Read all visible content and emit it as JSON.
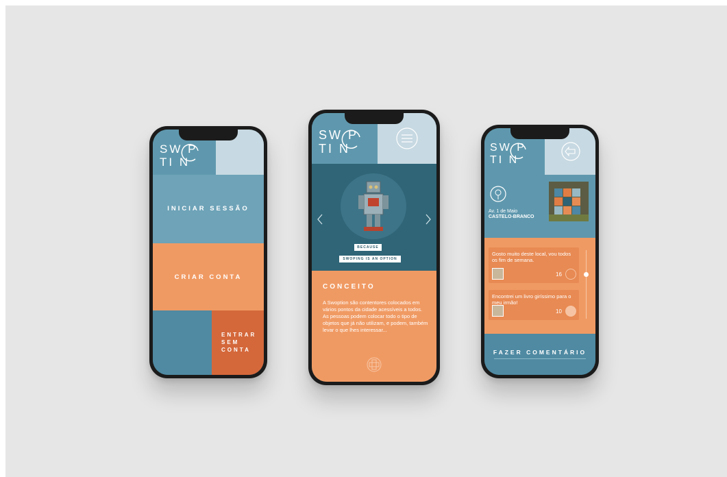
{
  "brand": {
    "logo_line1": "SW P",
    "logo_line2": "TI N"
  },
  "phone_left": {
    "login_label": "INICIAR SESSÃO",
    "signup_label": "CRIAR CONTA",
    "guest_label_1": "ENTRAR",
    "guest_label_2": "SEM",
    "guest_label_3": "CONTA"
  },
  "phone_center": {
    "tag_1": "BECAUSE",
    "tag_2": "SWOPING IS AN OPTION",
    "section_title": "CONCEITO",
    "body": "A Swoption são contentores colocados em vários pontos da cidade acessíveis a todos. As pessoas podem colocar todo o tipo de objetos que já não utilizam, e podem, também levar o que lhes interessar...",
    "prev_icon": "chevron-left-icon",
    "next_icon": "chevron-right-icon",
    "menu_icon": "menu-icon",
    "add_icon": "plus-icon"
  },
  "phone_right": {
    "location_line1": "Av. 1 de Maio",
    "location_line2": "CASTELO-BRANCO",
    "comments": [
      {
        "text": "Gosto muito deste local, vou todos os fim de semana.",
        "count": "16"
      },
      {
        "text": "Encontrei um livro giríssimo para o meu irmão!",
        "count": "10"
      }
    ],
    "cta_label": "FAZER COMENTÁRIO",
    "back_icon": "back-arrow-icon",
    "pin_icon": "location-pin-icon"
  },
  "colors": {
    "blue": "#5f98ae",
    "light_blue": "#c7d9e2",
    "orange": "#f09a63",
    "dark_orange": "#d4683b",
    "teal": "#2f6577"
  }
}
